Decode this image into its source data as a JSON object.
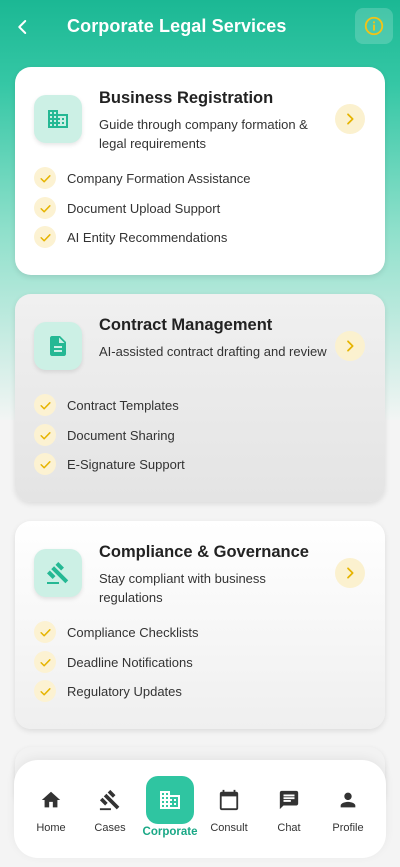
{
  "header": {
    "title": "Corporate Legal Services",
    "back_icon": "arrow-back-icon",
    "info_icon": "info-icon"
  },
  "colors": {
    "primary": "#1bb894",
    "accent_yellow": "#f3c316",
    "icon_bg": "#ccf0e5"
  },
  "services": [
    {
      "title": "Business Registration",
      "description": "Guide through company formation & legal requirements",
      "icon": "business-icon",
      "features": [
        "Company Formation Assistance",
        "Document Upload Support",
        "AI Entity Recommendations"
      ]
    },
    {
      "title": "Contract Management",
      "description": "AI-assisted contract drafting and review",
      "icon": "document-icon",
      "features": [
        "Contract Templates",
        "Document Sharing",
        "E-Signature Support"
      ]
    },
    {
      "title": "Compliance & Governance",
      "description": "Stay compliant with business regulations",
      "icon": "gavel-icon",
      "features": [
        "Compliance Checklists",
        "Deadline Notifications",
        "Regulatory Updates"
      ]
    }
  ],
  "nav": [
    {
      "label": "Home",
      "icon": "home-icon"
    },
    {
      "label": "Cases",
      "icon": "gavel-icon"
    },
    {
      "label": "Corporate",
      "icon": "business-icon",
      "active": true
    },
    {
      "label": "Consult",
      "icon": "calendar-icon"
    },
    {
      "label": "Chat",
      "icon": "chat-icon"
    },
    {
      "label": "Profile",
      "icon": "person-icon"
    }
  ]
}
